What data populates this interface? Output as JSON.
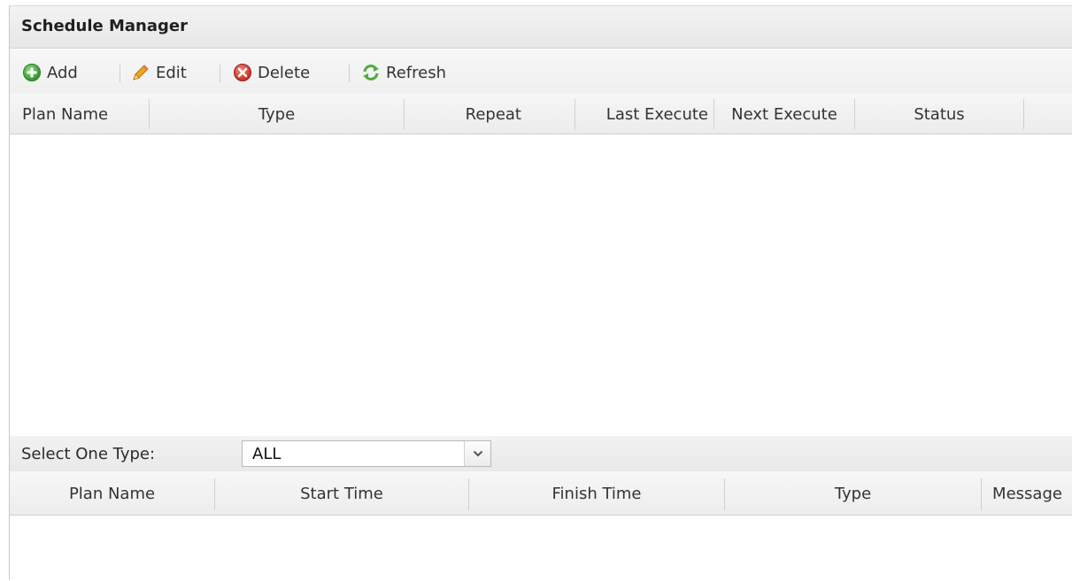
{
  "panel": {
    "title": "Schedule Manager"
  },
  "toolbar": {
    "add": {
      "label": "Add",
      "icon": "add-icon"
    },
    "edit": {
      "label": "Edit",
      "icon": "pencil-icon"
    },
    "delete": {
      "label": "Delete",
      "icon": "delete-icon"
    },
    "refresh": {
      "label": "Refresh",
      "icon": "refresh-icon"
    }
  },
  "plans_grid": {
    "columns": [
      "Plan Name",
      "Type",
      "Repeat",
      "Last Execute",
      "Next Execute",
      "Status"
    ],
    "rows": []
  },
  "filter": {
    "label": "Select One Type:",
    "selected": "ALL"
  },
  "log_grid": {
    "columns": [
      "Plan Name",
      "Start Time",
      "Finish Time",
      "Type",
      "Message"
    ],
    "rows": []
  },
  "colors": {
    "add_green": "#3aa53a",
    "edit_orange": "#f0a01e",
    "delete_red": "#d9382c",
    "refresh_green": "#5bb544"
  }
}
